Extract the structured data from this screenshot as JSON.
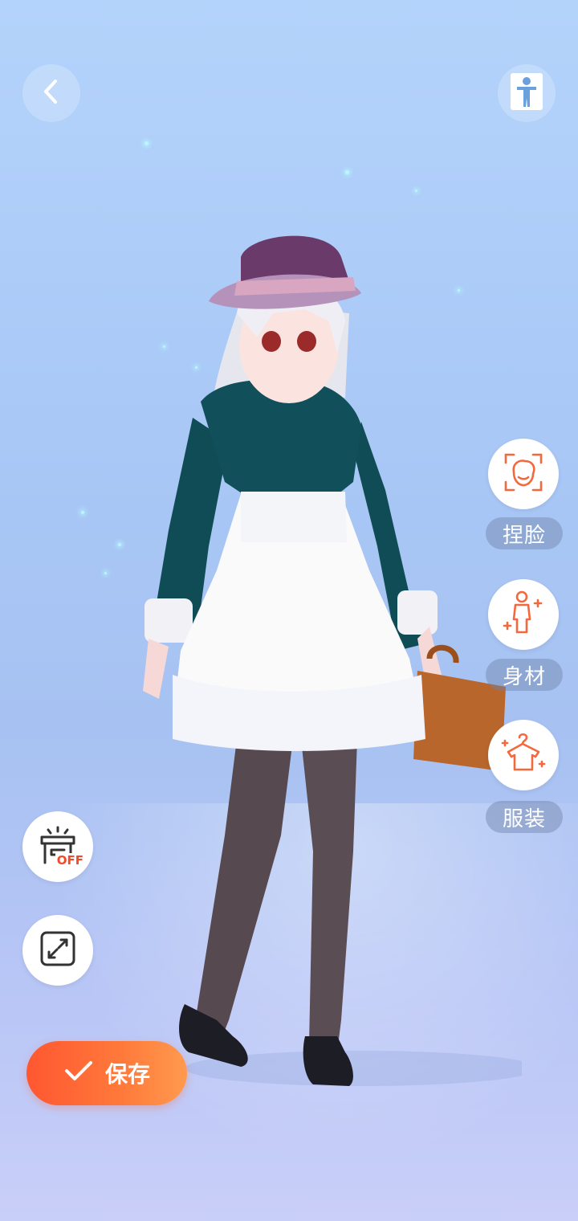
{
  "header": {
    "back_icon": "chevron-left-icon",
    "pose_icon": "standing-figure-icon"
  },
  "side_menu": {
    "items": [
      {
        "label": "捏脸",
        "icon": "face-icon"
      },
      {
        "label": "身材",
        "icon": "body-figure-icon"
      },
      {
        "label": "服装",
        "icon": "clothes-hanger-icon"
      }
    ]
  },
  "tools": {
    "off_badge": "OFF",
    "items": [
      {
        "icon": "lamp-off-icon"
      },
      {
        "icon": "expand-icon"
      }
    ]
  },
  "footer": {
    "save_label": "保存",
    "save_icon": "check-icon"
  },
  "colors": {
    "accent_start": "#ff5731",
    "accent_end": "#ff9a4f",
    "icon_orange": "#f4683e"
  }
}
